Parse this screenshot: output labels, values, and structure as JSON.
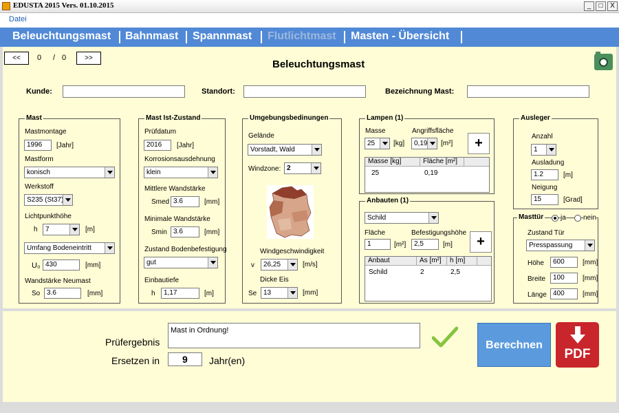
{
  "window": {
    "title": "EDUSTA 2015 Vers. 01.10.2015",
    "min": "_",
    "max": "□",
    "close": "X"
  },
  "menu": {
    "file": "Datei"
  },
  "tabs": [
    "Beleuchtungsmast",
    "Bahnmast",
    "Spannmast",
    "Flutlichtmast",
    "Masten - Übersicht"
  ],
  "nav": {
    "prev": "<<",
    "next": ">>",
    "current": "0",
    "sep": "/",
    "total": "0"
  },
  "page_title": "Beleuchtungsmast",
  "header_fields": {
    "kunde_label": "Kunde:",
    "standort_label": "Standort:",
    "bezeichnung_label": "Bezeichnung Mast:"
  },
  "mast": {
    "title": "Mast",
    "montage_label": "Mastmontage",
    "montage_value": "1996",
    "montage_unit": "[Jahr]",
    "form_label": "Mastform",
    "form_value": "konisch",
    "werkstoff_label": "Werkstoff",
    "werkstoff_value": "S235 (St37)",
    "lph_label": "Lichtpunkthöhe",
    "lph_sym": "h",
    "lph_value": "7",
    "lph_unit": "[m]",
    "umfang_select": "Umfang Bodeneintritt",
    "umfang_sym": "U₀",
    "umfang_value": "430",
    "umfang_unit": "[mm]",
    "wand_label": "Wandstärke Neumast",
    "wand_sym": "So",
    "wand_value": "3.6",
    "wand_unit": "[mm]"
  },
  "ist": {
    "title": "Mast Ist-Zustand",
    "pruef_label": "Prüfdatum",
    "pruef_value": "2016",
    "pruef_unit": "[Jahr]",
    "korr_label": "Korrosionsausdehnung",
    "korr_value": "klein",
    "mittel_label": "Mittlere Wandstärke",
    "smed_sym": "Smed",
    "smed_value": "3.6",
    "smed_unit": "[mm]",
    "min_label": "Minimale Wandstärke",
    "smin_sym": "Smin",
    "smin_value": "3.6",
    "smin_unit": "[mm]",
    "zustand_label": "Zustand Bodenbefestigung",
    "zustand_value": "gut",
    "einbau_label": "Einbautiefe",
    "einbau_sym": "h",
    "einbau_value": "1,17",
    "einbau_unit": "[m]"
  },
  "umgebung": {
    "title": "Umgebungsbedinungen",
    "gelaende_label": "Gelände",
    "gelaende_value": "Vorstadt, Wald",
    "windzone_label": "Windzone:",
    "windzone_value": "2",
    "windgeschw_label": "Windgeschwindigkeit",
    "v_sym": "v",
    "v_value": "26,25",
    "v_unit": "[m/s]",
    "eis_label": "Dicke Eis",
    "se_sym": "Se",
    "se_value": "13",
    "se_unit": "[mm]"
  },
  "lampen": {
    "title": "Lampen (1)",
    "masse_label": "Masse",
    "masse_value": "25",
    "masse_unit": "[kg]",
    "flaeche_label": "Angriffsfläche",
    "flaeche_value": "0,19",
    "flaeche_unit": "[m²]",
    "plus": "+",
    "columns": [
      "Masse [kg]",
      "Fläche [m²]"
    ],
    "rows": [
      [
        "25",
        "0,19"
      ]
    ]
  },
  "anbauten": {
    "title": "Anbauten (1)",
    "type_value": "Schild",
    "flaeche_label": "Fläche",
    "flaeche_value": "1",
    "flaeche_unit": "[m²]",
    "hoehe_label": "Befestigungshöhe",
    "hoehe_value": "2,5",
    "hoehe_unit": "[m]",
    "plus": "+",
    "columns": [
      "Anbaut",
      "As [m²]",
      "h [m]"
    ],
    "rows": [
      [
        "Schild",
        "2",
        "2,5"
      ]
    ]
  },
  "ausleger": {
    "title": "Ausleger",
    "anzahl_label": "Anzahl",
    "anzahl_value": "1",
    "ausladung_label": "Ausladung",
    "ausladung_value": "1.2",
    "ausladung_unit": "[m]",
    "neigung_label": "Neigung",
    "neigung_value": "15",
    "neigung_unit": "[Grad]"
  },
  "masttuer": {
    "title": "Masttür",
    "ja": "ja",
    "nein": "nein",
    "selected": "ja",
    "zustand_label": "Zustand Tür",
    "zustand_value": "Presspassung",
    "hoehe_label": "Höhe",
    "hoehe_value": "600",
    "hoehe_unit": "[mm]",
    "breite_label": "Breite",
    "breite_value": "100",
    "breite_unit": "[mm]",
    "laenge_label": "Länge",
    "laenge_value": "400",
    "laenge_unit": "[mm]"
  },
  "result": {
    "pruef_label": "Prüfergebnis",
    "pruef_value": "Mast in Ordnung!",
    "ersetzen_label": "Ersetzen in",
    "ersetzen_value": "9",
    "ersetzen_unit": "Jahr(en)",
    "berechnen": "Berechnen",
    "pdf": "PDF"
  },
  "colors": {
    "tabbar": "#5189d6",
    "panel": "#fffdd6",
    "button": "#5b9bdd",
    "pdf": "#c9252c",
    "check": "#86c440"
  }
}
